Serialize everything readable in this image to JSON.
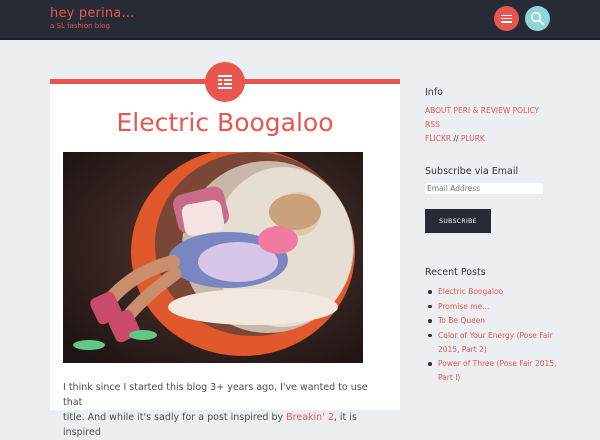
{
  "site": {
    "title": "hey perina...",
    "tagline": "a SL fashion blog",
    "accent_color": "#e9564f",
    "header_color": "#262b35",
    "search_color": "#8ed6dc"
  },
  "header": {
    "menu_icon": "menu-icon",
    "search_icon": "search-icon"
  },
  "post": {
    "format_icon": "standard-post-icon",
    "title": "Electric Boogaloo",
    "image_alt": "avatar lounging in an egg chair",
    "excerpt_line1": "I think since I started this blog 3+ years ago, I've wanted to use that",
    "excerpt_line2_start": "title. And while it's sadly for a post inspired by ",
    "excerpt_line2_link": "Breakin' 2",
    "excerpt_line2_end": ", it is inspired"
  },
  "sidebar": {
    "info": {
      "title": "Info",
      "link1": "ABOUT PERI & REVIEW POLICY",
      "link2": "RSS",
      "link3a": "FLICKR",
      "link3_sep": " // ",
      "link3b": "PLURK"
    },
    "subscribe": {
      "title": "Subscribe via Email",
      "placeholder": "Email Address",
      "button": "SUBSCRIBE"
    },
    "recent": {
      "title": "Recent Posts",
      "items": [
        "Electric Boogaloo",
        "Promise me...",
        "To Be Queen",
        "Color of Your Energy (Pose Fair 2015, Part 2)",
        "Power of Three (Pose Fair 2015, Part I)"
      ]
    }
  }
}
